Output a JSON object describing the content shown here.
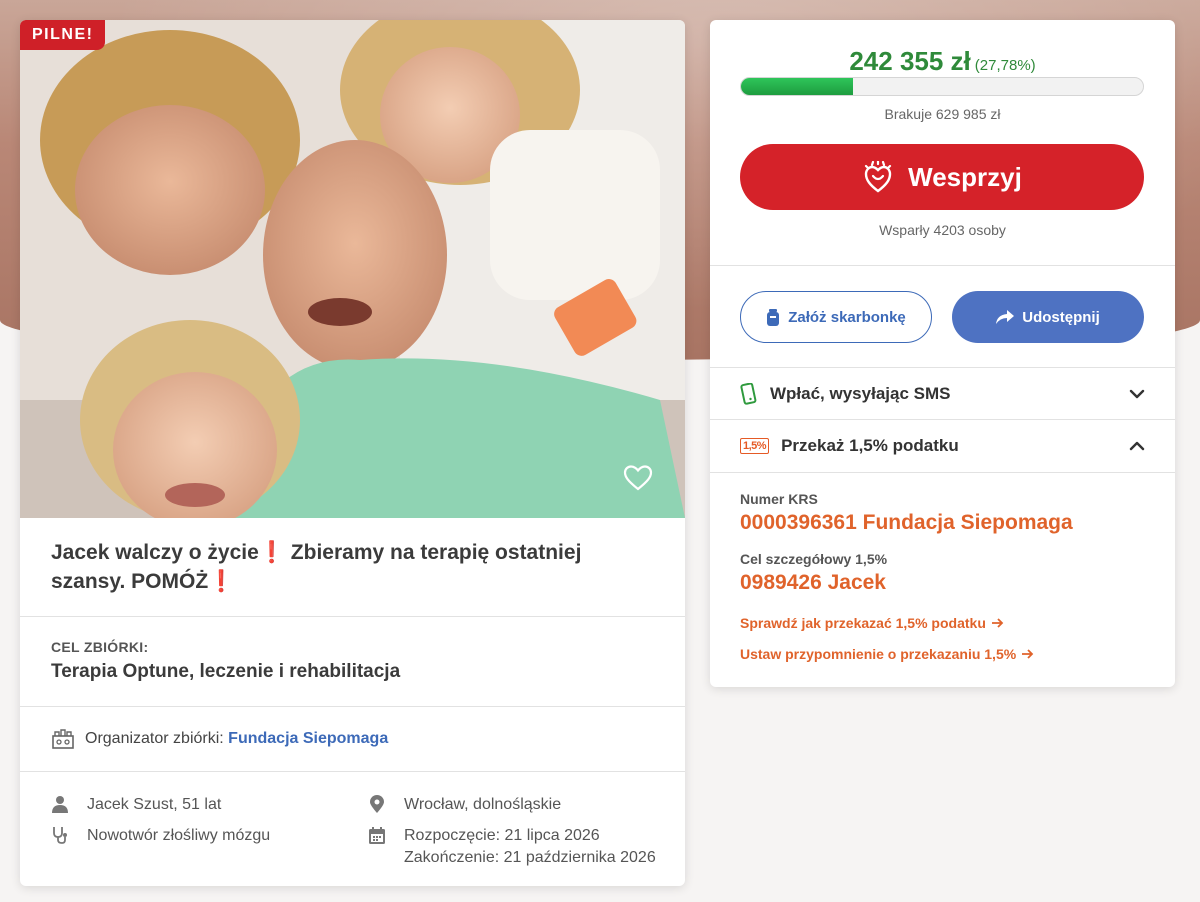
{
  "campaign": {
    "urgent_badge": "PILNE!",
    "title_part1": "Jacek walczy o życie",
    "title_excl": "❗",
    "title_part2": " Zbieramy na terapię ostatniej szansy. POMÓŻ",
    "goal_label": "CEL ZBIÓRKI:",
    "goal_text": "Terapia Optune, leczenie i rehabilitacja",
    "organizer_label": "Organizator zbiórki: ",
    "organizer_name": "Fundacja Siepomaga",
    "person": "Jacek Szust, 51 lat",
    "diagnosis": "Nowotwór złośliwy mózgu",
    "location": "Wrocław, dolnośląskie",
    "start": "Rozpoczęcie: 21 lipca 2026",
    "end": "Zakończenie: 21 października 2026"
  },
  "donation": {
    "amount": "242 355 zł",
    "percent_text": "(27,78%)",
    "progress": 0.2778,
    "missing": "Brakuje 629 985 zł",
    "donate_label": "Wesprzyj",
    "supporters": "Wsparły 4203 osoby",
    "piggy_label": "Załóż skarbonkę",
    "share_label": "Udostępnij",
    "sms_label": "Wpłać, wysyłając SMS",
    "tax_badge": "1,5%",
    "tax_label": "Przekaż 1,5% podatku",
    "krs_label": "Numer KRS",
    "krs_value": "0000396361 Fundacja Siepomaga",
    "goal_label": "Cel szczegółowy 1,5%",
    "goal_value": "0989426 Jacek",
    "link1": "Sprawdź jak przekazać 1,5% podatku",
    "link2": "Ustaw przypomnienie o przekazaniu 1,5%"
  },
  "colors": {
    "brand_red": "#d52229",
    "green": "#2f8a3a",
    "blue": "#3d6ab8",
    "orange": "#e0632b"
  },
  "icons": [
    "heart-outline-icon",
    "hand-heart-icon",
    "piggy-jar-icon",
    "share-arrow-icon",
    "phone-icon",
    "chevron-down-icon",
    "chevron-up-icon",
    "person-icon",
    "stethoscope-icon",
    "location-pin-icon",
    "calendar-icon",
    "organizer-icon",
    "arrow-right-icon"
  ]
}
